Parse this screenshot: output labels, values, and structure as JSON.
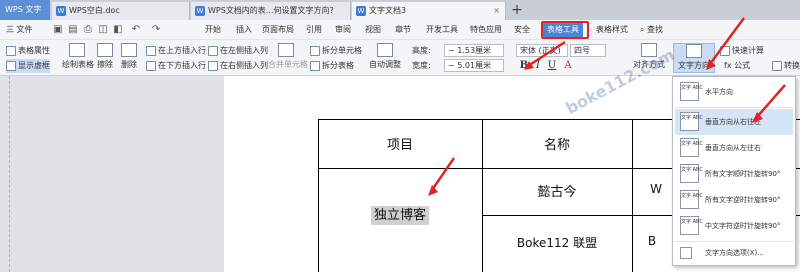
{
  "tabs": {
    "app": "WPS 文字",
    "docs": [
      {
        "label": "WPS空白.doc"
      },
      {
        "label": "WPS文档内的表...何设置文字方向?"
      },
      {
        "label": "文字文档3"
      }
    ],
    "add": "+"
  },
  "menu": {
    "file": "三 文件",
    "items": [
      "开始",
      "插入",
      "页面布局",
      "引用",
      "审阅",
      "视图",
      "章节",
      "开发工具",
      "特色应用",
      "安全",
      "表格工具",
      "表格样式"
    ],
    "active": "表格工具",
    "search": "查找"
  },
  "ribbon": {
    "table_props": "表格属性",
    "show_gridlines": "显示虚框",
    "draw_table": "绘制表格",
    "erase": "擦除",
    "delete": "删除",
    "insert_above": "在上方插入行",
    "insert_below": "在下方插入行",
    "insert_left": "在左侧插入列",
    "insert_right": "在右侧插入列",
    "merge_cells": "合并单元格",
    "split_cells": "拆分单元格",
    "split_table": "拆分表格",
    "autofit": "自动调整",
    "height_label": "高度:",
    "height_value": "1.53厘米",
    "width_label": "宽度:",
    "width_value": "5.01厘米",
    "font_name": "宋体 (正文)",
    "font_size": "四号",
    "align": "对齐方式",
    "text_direction": "文字方向",
    "quick_calc": "快速计算",
    "formula": "fx 公式",
    "convert": "转换"
  },
  "table": {
    "header": [
      "项目",
      "名称",
      ""
    ],
    "r1c1": "独立博客",
    "r1c2": "懿古今",
    "r1c3": "W",
    "r2c2": "Boke112 联盟",
    "r2c3": "B"
  },
  "dropdown": {
    "items": [
      {
        "label": "水平方向",
        "icon": "文字 ABC"
      },
      {
        "label": "垂直方向从右往左",
        "icon": "文字 ABC"
      },
      {
        "label": "垂直方向从左往右",
        "icon": "文字 ABC"
      },
      {
        "label": "所有文字顺时针旋转90°",
        "icon": "文字 ABC"
      },
      {
        "label": "所有文字逆时针旋转90°",
        "icon": "文字 ABC"
      },
      {
        "label": "中文字符逆时针旋转90°",
        "icon": "文字 ABC"
      }
    ],
    "more": "文字方向选项(X)..."
  },
  "watermark": "boke112.com",
  "colors": {
    "accent": "#4a84d4",
    "annotation": "#e02424"
  }
}
